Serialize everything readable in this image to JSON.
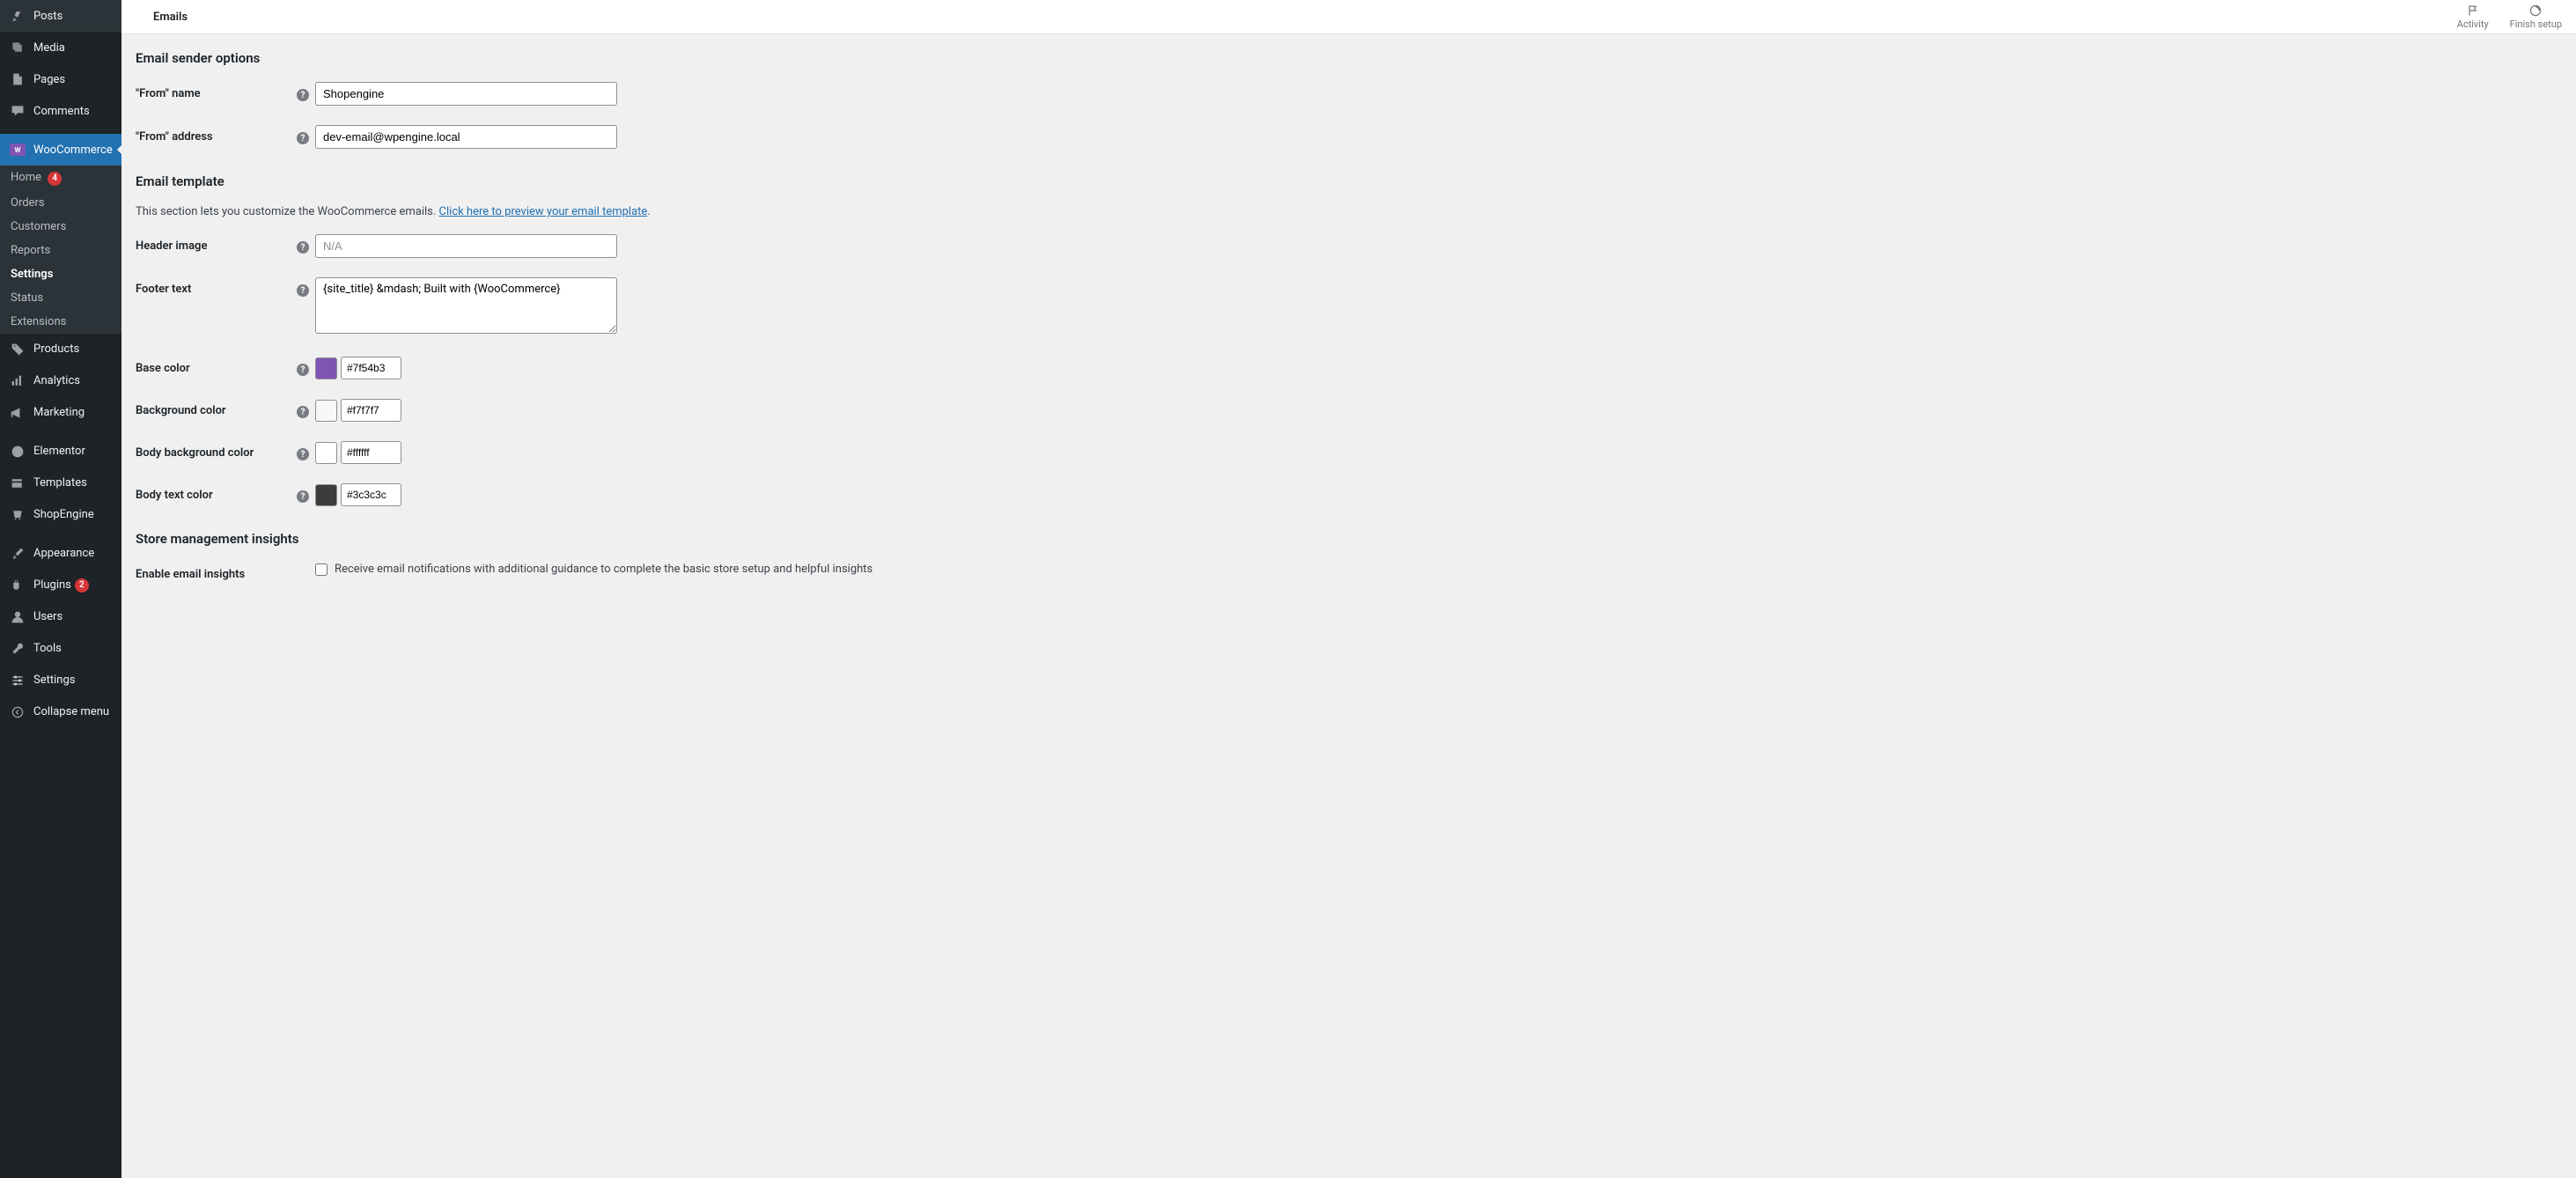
{
  "topbar": {
    "title": "Emails",
    "activity_label": "Activity",
    "finish_label": "Finish setup"
  },
  "sidebar": {
    "posts": "Posts",
    "media": "Media",
    "pages": "Pages",
    "comments": "Comments",
    "woocommerce": "WooCommerce",
    "sub": {
      "home": "Home",
      "home_badge": "4",
      "orders": "Orders",
      "customers": "Customers",
      "reports": "Reports",
      "settings": "Settings",
      "status": "Status",
      "extensions": "Extensions"
    },
    "products": "Products",
    "analytics": "Analytics",
    "marketing": "Marketing",
    "elementor": "Elementor",
    "templates": "Templates",
    "shopengine": "ShopEngine",
    "appearance": "Appearance",
    "plugins": "Plugins",
    "plugins_badge": "2",
    "users": "Users",
    "tools": "Tools",
    "settings_main": "Settings",
    "collapse": "Collapse menu"
  },
  "sections": {
    "email_sender": {
      "title": "Email sender options",
      "from_name_label": "\"From\" name",
      "from_name_value": "Shopengine",
      "from_address_label": "\"From\" address",
      "from_address_value": "dev-email@wpengine.local"
    },
    "email_template": {
      "title": "Email template",
      "desc_prefix": "This section lets you customize the WooCommerce emails. ",
      "desc_link": "Click here to preview your email template",
      "desc_suffix": ".",
      "header_image_label": "Header image",
      "header_image_placeholder": "N/A",
      "footer_text_label": "Footer text",
      "footer_text_value": "{site_title} &mdash; Built with {WooCommerce}",
      "base_color_label": "Base color",
      "base_color_value": "#7f54b3",
      "bg_color_label": "Background color",
      "bg_color_value": "#f7f7f7",
      "body_bg_label": "Body background color",
      "body_bg_value": "#ffffff",
      "body_text_label": "Body text color",
      "body_text_value": "#3c3c3c"
    },
    "store_insights": {
      "title": "Store management insights",
      "enable_label": "Enable email insights",
      "checkbox_label": "Receive email notifications with additional guidance to complete the basic store setup and helpful insights"
    }
  },
  "colors": {
    "base": "#7f54b3",
    "bg": "#f7f7f7",
    "body_bg": "#ffffff",
    "body_text": "#3c3c3c"
  }
}
